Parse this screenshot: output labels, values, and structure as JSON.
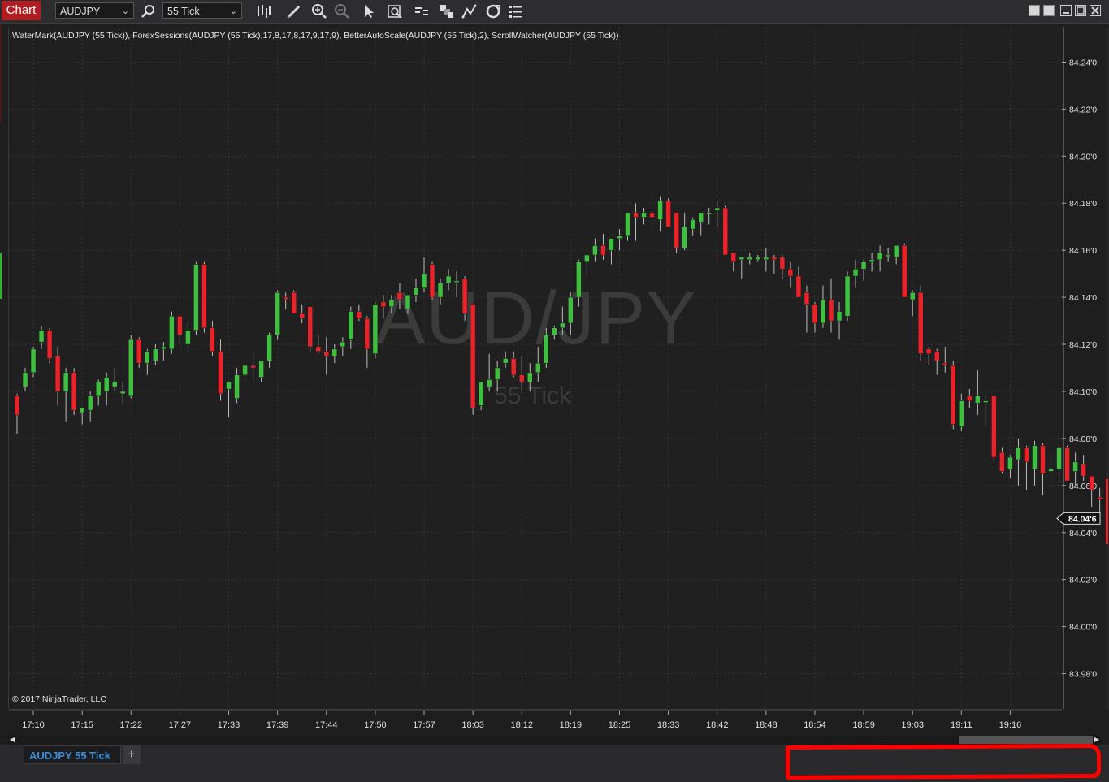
{
  "toolbar": {
    "chart_label": "Chart",
    "instrument": "AUDJPY",
    "interval": "55 Tick",
    "icons": [
      "search-icon",
      "bar-type-icon",
      "pencil-icon",
      "zoom-in-icon",
      "zoom-out-icon",
      "pointer-icon",
      "data-box-icon",
      "indicators-icon",
      "strategies-icon",
      "drawing-tools-icon",
      "refresh-icon",
      "properties-icon"
    ],
    "window_buttons": [
      "tile-icon",
      "tile2-icon",
      "minimize-icon",
      "maximize-icon",
      "close-icon"
    ]
  },
  "indicator_line": "WaterMark(AUDJPY (55 Tick)), ForexSessions(AUDJPY (55 Tick),17,8,17,8,17,9,17,9), BetterAutoScale(AUDJPY (55 Tick),2), ScrollWatcher(AUDJPY (55 Tick))",
  "watermark": {
    "symbol": "AUD/JPY",
    "interval": "55 Tick"
  },
  "copyright": "© 2017 NinjaTrader, LLC",
  "colors": {
    "up": "#3fbf3f",
    "down": "#e8232a",
    "background": "#202020",
    "grid": "#353535",
    "highlight": "#ff0000"
  },
  "chart_data": {
    "type": "candlestick",
    "y_axis": {
      "min": 83.965,
      "max": 84.255,
      "ticks": [
        "84.24'0",
        "84.22'0",
        "84.20'0",
        "84.18'0",
        "84.16'0",
        "84.14'0",
        "84.12'0",
        "84.10'0",
        "84.08'0",
        "84.06'0",
        "84.04'0",
        "84.02'0",
        "84.00'0",
        "83.98'0"
      ],
      "tick_values": [
        84.24,
        84.22,
        84.2,
        84.18,
        84.16,
        84.14,
        84.12,
        84.1,
        84.08,
        84.06,
        84.04,
        84.02,
        84.0,
        83.98
      ]
    },
    "last_price": {
      "label": "84.04'6",
      "value": 84.046
    },
    "x_axis": {
      "labels": [
        "17:10",
        "17:15",
        "17:22",
        "17:27",
        "17:33",
        "17:39",
        "17:44",
        "17:50",
        "17:57",
        "18:03",
        "18:12",
        "18:19",
        "18:25",
        "18:33",
        "18:42",
        "18:48",
        "18:54",
        "18:59",
        "19:03",
        "19:11",
        "19:16"
      ],
      "label_bar_index": [
        2,
        8,
        14,
        20,
        26,
        32,
        38,
        44,
        50,
        56,
        62,
        68,
        74,
        80,
        86,
        92,
        98,
        104,
        110,
        116,
        122
      ]
    },
    "grid": true,
    "candles": [
      [
        84.098,
        84.099,
        84.082,
        84.09
      ],
      [
        84.102,
        84.11,
        84.1,
        84.108
      ],
      [
        84.108,
        84.119,
        84.106,
        84.118
      ],
      [
        84.121,
        84.128,
        84.118,
        84.126
      ],
      [
        84.126,
        84.127,
        84.112,
        84.114
      ],
      [
        84.115,
        84.119,
        84.094,
        84.1
      ],
      [
        84.1,
        84.11,
        84.087,
        84.108
      ],
      [
        84.108,
        84.11,
        84.09,
        84.092
      ],
      [
        84.091,
        84.093,
        84.086,
        84.093
      ],
      [
        84.092,
        84.1,
        84.087,
        84.098
      ],
      [
        84.098,
        84.105,
        84.094,
        84.104
      ],
      [
        84.1,
        84.108,
        84.094,
        84.106
      ],
      [
        84.102,
        84.11,
        84.1,
        84.104
      ],
      [
        84.099,
        84.104,
        84.095,
        84.1
      ],
      [
        84.098,
        84.124,
        84.097,
        84.122
      ],
      [
        84.122,
        84.123,
        84.11,
        84.112
      ],
      [
        84.112,
        84.118,
        84.107,
        84.117
      ],
      [
        84.113,
        84.12,
        84.111,
        84.118
      ],
      [
        84.118,
        84.121,
        84.113,
        84.119
      ],
      [
        84.118,
        84.134,
        84.116,
        84.132
      ],
      [
        84.132,
        84.133,
        84.12,
        84.124
      ],
      [
        84.12,
        84.129,
        84.117,
        84.126
      ],
      [
        84.126,
        84.155,
        84.124,
        84.154
      ],
      [
        84.154,
        84.155,
        84.125,
        84.127
      ],
      [
        84.127,
        84.13,
        84.115,
        84.117
      ],
      [
        84.117,
        84.122,
        84.096,
        84.099
      ],
      [
        84.101,
        84.104,
        84.089,
        84.104
      ],
      [
        84.097,
        84.11,
        84.095,
        84.107
      ],
      [
        84.107,
        84.112,
        84.104,
        84.111
      ],
      [
        84.111,
        84.117,
        84.104,
        84.11
      ],
      [
        84.106,
        84.112,
        84.104,
        84.113
      ],
      [
        84.113,
        84.125,
        84.11,
        84.124
      ],
      [
        84.124,
        84.143,
        84.122,
        84.142
      ],
      [
        84.14,
        84.142,
        84.135,
        84.139
      ],
      [
        84.142,
        84.143,
        84.133,
        84.133
      ],
      [
        84.133,
        84.137,
        84.129,
        84.131
      ],
      [
        84.136,
        84.136,
        84.117,
        84.119
      ],
      [
        84.119,
        84.124,
        84.116,
        84.117
      ],
      [
        84.117,
        84.123,
        84.107,
        84.115
      ],
      [
        84.115,
        84.12,
        84.112,
        84.118
      ],
      [
        84.119,
        84.123,
        84.115,
        84.121
      ],
      [
        84.122,
        84.136,
        84.118,
        84.134
      ],
      [
        84.134,
        84.137,
        84.13,
        84.131
      ],
      [
        84.131,
        84.132,
        84.11,
        84.118
      ],
      [
        84.116,
        84.138,
        84.114,
        84.137
      ],
      [
        84.138,
        84.141,
        84.131,
        84.136
      ],
      [
        84.136,
        84.141,
        84.133,
        84.139
      ],
      [
        84.142,
        84.146,
        84.135,
        84.139
      ],
      [
        84.135,
        84.14,
        84.133,
        84.141
      ],
      [
        84.141,
        84.148,
        84.138,
        84.144
      ],
      [
        84.144,
        84.157,
        84.142,
        84.15
      ],
      [
        84.154,
        84.155,
        84.139,
        84.14
      ],
      [
        84.14,
        84.148,
        84.137,
        84.146
      ],
      [
        84.146,
        84.152,
        84.143,
        84.149
      ],
      [
        84.147,
        84.151,
        84.14,
        84.147
      ],
      [
        84.148,
        84.149,
        84.13,
        84.133
      ],
      [
        84.137,
        84.137,
        84.09,
        84.093
      ],
      [
        84.094,
        84.102,
        84.092,
        84.104
      ],
      [
        84.102,
        84.116,
        84.1,
        84.105
      ],
      [
        84.105,
        84.113,
        84.1,
        84.11
      ],
      [
        84.112,
        84.117,
        84.11,
        84.114
      ],
      [
        84.114,
        84.117,
        84.106,
        84.107
      ],
      [
        84.107,
        84.115,
        84.1,
        84.104
      ],
      [
        84.104,
        84.112,
        84.1,
        84.108
      ],
      [
        84.108,
        84.119,
        84.104,
        84.112
      ],
      [
        84.112,
        84.127,
        84.11,
        84.124
      ],
      [
        84.124,
        84.128,
        84.122,
        84.127
      ],
      [
        84.127,
        84.136,
        84.124,
        84.129
      ],
      [
        84.129,
        84.142,
        84.124,
        84.14
      ],
      [
        84.14,
        84.156,
        84.136,
        84.155
      ],
      [
        84.155,
        84.158,
        84.15,
        84.158
      ],
      [
        84.158,
        84.165,
        84.155,
        84.162
      ],
      [
        84.162,
        84.167,
        84.156,
        84.158
      ],
      [
        84.16,
        84.165,
        84.154,
        84.165
      ],
      [
        84.165,
        84.169,
        84.16,
        84.166
      ],
      [
        84.166,
        84.176,
        84.164,
        84.176
      ],
      [
        84.176,
        84.18,
        84.164,
        84.174
      ],
      [
        84.174,
        84.178,
        84.171,
        84.176
      ],
      [
        84.176,
        84.181,
        84.171,
        84.174
      ],
      [
        84.173,
        84.183,
        84.168,
        84.181
      ],
      [
        84.181,
        84.182,
        84.17,
        84.17
      ],
      [
        84.176,
        84.176,
        84.159,
        84.161
      ],
      [
        84.161,
        84.176,
        84.16,
        84.17
      ],
      [
        84.169,
        84.174,
        84.166,
        84.173
      ],
      [
        84.172,
        84.175,
        84.166,
        84.176
      ],
      [
        84.176,
        84.178,
        84.171,
        84.176
      ],
      [
        84.177,
        84.181,
        84.17,
        84.178
      ],
      [
        84.178,
        84.179,
        84.158,
        84.158
      ],
      [
        84.159,
        84.159,
        84.151,
        84.155
      ],
      [
        84.156,
        84.157,
        84.148,
        84.157
      ],
      [
        84.156,
        84.159,
        84.154,
        84.157
      ],
      [
        84.156,
        84.158,
        84.155,
        84.157
      ],
      [
        84.156,
        84.161,
        84.151,
        84.157
      ],
      [
        84.157,
        84.158,
        84.15,
        84.156
      ],
      [
        84.157,
        84.158,
        84.148,
        84.152
      ],
      [
        84.152,
        84.155,
        84.144,
        84.149
      ],
      [
        84.149,
        84.153,
        84.14,
        84.14
      ],
      [
        84.142,
        84.145,
        84.125,
        84.137
      ],
      [
        84.137,
        84.138,
        84.125,
        84.129
      ],
      [
        84.129,
        84.145,
        84.127,
        84.139
      ],
      [
        84.139,
        84.148,
        84.125,
        84.13
      ],
      [
        84.13,
        84.138,
        84.122,
        84.134
      ],
      [
        84.132,
        84.151,
        84.13,
        84.149
      ],
      [
        84.149,
        84.156,
        84.144,
        84.152
      ],
      [
        84.152,
        84.156,
        84.147,
        84.155
      ],
      [
        84.155,
        84.159,
        84.151,
        84.156
      ],
      [
        84.156,
        84.162,
        84.151,
        84.159
      ],
      [
        84.158,
        84.161,
        84.155,
        84.158
      ],
      [
        84.157,
        84.16,
        84.154,
        84.162
      ],
      [
        84.162,
        84.163,
        84.14,
        84.14
      ],
      [
        84.139,
        84.143,
        84.132,
        84.142
      ],
      [
        84.142,
        84.145,
        84.113,
        84.116
      ],
      [
        84.118,
        84.119,
        84.111,
        84.116
      ],
      [
        84.117,
        84.118,
        84.107,
        84.113
      ],
      [
        84.112,
        84.119,
        84.108,
        84.111
      ],
      [
        84.111,
        84.113,
        84.084,
        84.086
      ],
      [
        84.085,
        84.099,
        84.083,
        84.096
      ],
      [
        84.098,
        84.101,
        84.093,
        84.096
      ],
      [
        84.095,
        84.109,
        84.09,
        84.098
      ],
      [
        84.096,
        84.098,
        84.085,
        84.096
      ],
      [
        84.098,
        84.099,
        84.07,
        84.072
      ],
      [
        84.074,
        84.076,
        84.065,
        84.066
      ],
      [
        84.067,
        84.073,
        84.063,
        84.072
      ],
      [
        84.071,
        84.08,
        84.06,
        84.076
      ],
      [
        84.076,
        84.077,
        84.058,
        84.07
      ],
      [
        84.067,
        84.079,
        84.06,
        84.077
      ],
      [
        84.077,
        84.078,
        84.056,
        84.065
      ],
      [
        84.066,
        84.075,
        84.058,
        84.067
      ],
      [
        84.067,
        84.077,
        84.06,
        84.076
      ],
      [
        84.076,
        84.077,
        84.067,
        84.062
      ],
      [
        84.066,
        84.074,
        84.06,
        84.07
      ],
      [
        84.069,
        84.073,
        84.062,
        84.064
      ],
      [
        84.064,
        84.064,
        84.051,
        84.058
      ],
      [
        84.055,
        84.059,
        84.048,
        84.054
      ],
      [
        84.054,
        84.058,
        84.048,
        84.046
      ],
      [
        84.046,
        84.049,
        84.04,
        84.059
      ],
      [
        84.059,
        84.075,
        84.055,
        84.072
      ],
      [
        84.074,
        84.074,
        84.04,
        84.054
      ],
      [
        84.054,
        84.055,
        84.033,
        84.041
      ],
      [
        84.04,
        84.046,
        84.039,
        84.046
      ]
    ]
  },
  "tabs": [
    {
      "label": "AUDJPY 55 Tick",
      "active": true
    }
  ],
  "tab_add_label": "+"
}
